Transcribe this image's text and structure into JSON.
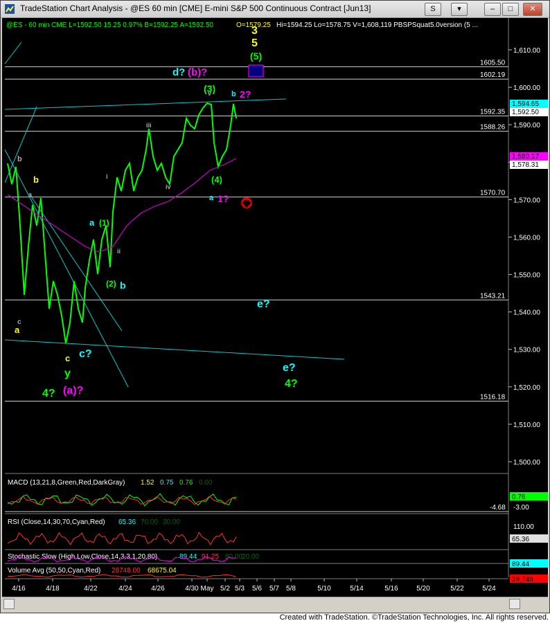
{
  "window": {
    "title": "TradeStation Chart Analysis - @ES 60 min [CME] E-mini S&P 500 Continuous Contract [Jun13]",
    "buttons": {
      "s": "S",
      "minimize": "–",
      "restore": "□",
      "close": "✕"
    }
  },
  "header": {
    "symbol": "@ES - 60 min  CME  L=1592.50  15.25  0.97%  B=1592.25  A=1592.50",
    "open": "O=1579.25",
    "rest": "Hi=1594.25  Lo=1578.75  V=1,608,119  PBSPSquat5.0version  (5 ..."
  },
  "price_axis": {
    "ticks": [
      "1,610.00",
      "1,600.00",
      "1,590.00",
      "1,580.00",
      "1,570.00",
      "1,560.00",
      "1,550.00",
      "1,540.00",
      "1,530.00",
      "1,520.00",
      "1,510.00",
      "1,500.00"
    ],
    "tags": [
      {
        "text": "1,594.65",
        "bg": "#00ffff",
        "fg": "#000000"
      },
      {
        "text": "1,592.50",
        "bg": "#ffffff",
        "fg": "#000000"
      },
      {
        "text": "1,580.17",
        "bg": "#ff00ff",
        "fg": "#000000"
      },
      {
        "text": "1,578.31",
        "bg": "#ffffff",
        "fg": "#000000"
      }
    ]
  },
  "levels": [
    "1605.50",
    "1602.19",
    "1592.35",
    "1588.26",
    "1570.70",
    "1543.21",
    "1516.18"
  ],
  "wave_labels": [
    {
      "text": "3",
      "color": "#ffff00"
    },
    {
      "text": "5",
      "color": "#ffff00"
    },
    {
      "text": "(5)",
      "color": "#00ff00"
    },
    {
      "text": "d?",
      "color": "#00ffff"
    },
    {
      "text": "(b)?",
      "color": "#ff00ff"
    },
    {
      "text": "(3)",
      "color": "#00ff00"
    },
    {
      "text": "b",
      "color": "#00ffff"
    },
    {
      "text": "2?",
      "color": "#ff00ff"
    },
    {
      "text": "v",
      "color": "#aaaaaa"
    },
    {
      "text": "iii",
      "color": "#aaaaaa"
    },
    {
      "text": "iv",
      "color": "#aaaaaa"
    },
    {
      "text": "(4)",
      "color": "#00ff00"
    },
    {
      "text": "a",
      "color": "#00ffff"
    },
    {
      "text": "1?",
      "color": "#ff00ff"
    },
    {
      "text": "b",
      "color": "#aaaaaa"
    },
    {
      "text": "b",
      "color": "#ffff00"
    },
    {
      "text": "a",
      "color": "#aaaaaa"
    },
    {
      "text": "a",
      "color": "#00ffff"
    },
    {
      "text": "(1)",
      "color": "#00ff00"
    },
    {
      "text": "i",
      "color": "#aaaaaa"
    },
    {
      "text": "ii",
      "color": "#aaaaaa"
    },
    {
      "text": "(2)",
      "color": "#00ff00"
    },
    {
      "text": "b",
      "color": "#00ffff"
    },
    {
      "text": "e?",
      "color": "#00ffff"
    },
    {
      "text": "c",
      "color": "#aaaaaa"
    },
    {
      "text": "a",
      "color": "#ffff00"
    },
    {
      "text": "c",
      "color": "#ffff00"
    },
    {
      "text": "c?",
      "color": "#00ffff"
    },
    {
      "text": "y",
      "color": "#00ff00"
    },
    {
      "text": "e?",
      "color": "#00ffff"
    },
    {
      "text": "4?",
      "color": "#00ff00"
    },
    {
      "text": "4?",
      "color": "#00ff00"
    },
    {
      "text": "(a)?",
      "color": "#ff00ff"
    }
  ],
  "macd": {
    "label": "MACD (13,21,8,Green,Red,DarkGray)",
    "v1": "1.52",
    "v2": "0.75",
    "v3": "0.76",
    "v4": "0.00",
    "axis": [
      "-3.00"
    ],
    "tag": "0.76",
    "level": "-4.68"
  },
  "rsi": {
    "label": "RSI (Close,14,30,70,Cyan,Red)",
    "v1": "65.36",
    "v2": "70.00",
    "v3": "30.00",
    "axis": [
      "110.00"
    ],
    "tag": "65.36"
  },
  "stoch": {
    "label": "Stochastic Slow (High,Low,Close,14,3,3,1,20,80)",
    "v1": "89.44",
    "v2": "91.25",
    "v3": "80.00",
    "v4": "20.00",
    "tag": "89.44"
  },
  "volume": {
    "label": "Volume Avg (50,50,Cyan,Red)",
    "v1": "28748.00",
    "v2": "68675.04",
    "tag": "28,748"
  },
  "date_axis": [
    "4/16",
    "4/18",
    "4/22",
    "4/24",
    "4/26",
    "4/30",
    "May",
    "5/2",
    "5/3",
    "5/6",
    "5/7",
    "5/8",
    "5/10",
    "5/14",
    "5/16",
    "5/20",
    "5/22",
    "5/24"
  ],
  "footer": "Created with TradeStation. ©TradeStation Technologies, Inc. All rights reserved.",
  "colors": {
    "bars": "#00ff00",
    "ma": "#ff00ff",
    "lines": "#00ffff",
    "bg": "#000000"
  }
}
